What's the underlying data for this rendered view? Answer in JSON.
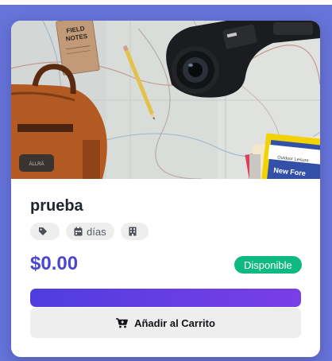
{
  "product": {
    "title": "prueba",
    "tags": [
      {
        "icon": "tag-icon",
        "text": ""
      },
      {
        "icon": "calendar-icon",
        "text": "días"
      },
      {
        "icon": "building-icon",
        "text": ""
      }
    ],
    "price": "$0.00",
    "availability": "Disponible",
    "add_to_cart_label": "Añadir al Carrito"
  },
  "image": {
    "notebook_text": [
      "FIELD",
      "NOTES"
    ],
    "book_text": "New Fore",
    "book_subtext": "Outdoor Leisure"
  },
  "colors": {
    "background": "#6673d9",
    "price": "#4a46cf",
    "badge": "#10b981",
    "gradient_start": "#4f3de0",
    "gradient_end": "#7a3ee6"
  }
}
